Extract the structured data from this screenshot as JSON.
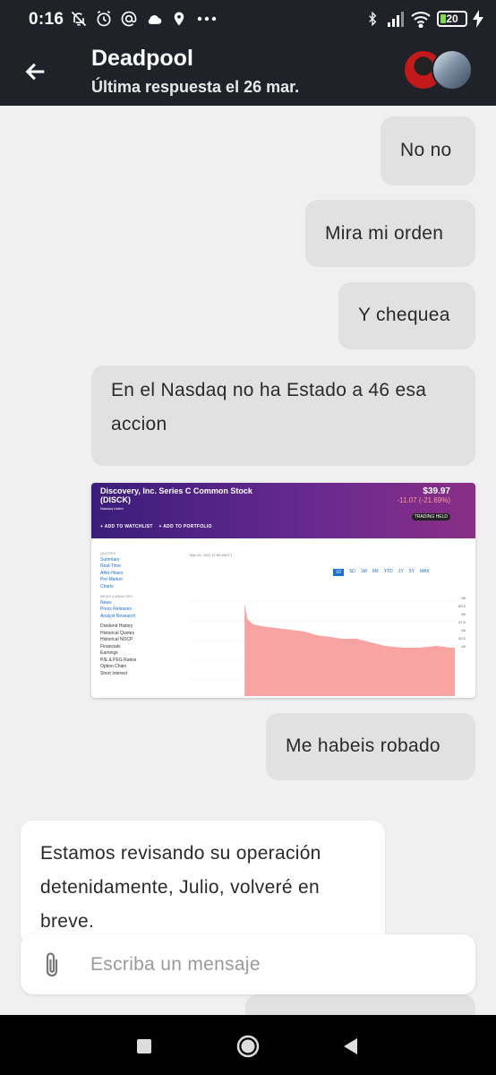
{
  "status_bar": {
    "time": "0:16",
    "battery_level": "20",
    "icons_left": [
      "notifications-off-icon",
      "alarm-icon",
      "at-icon",
      "cloud-icon",
      "location-icon",
      "more-dots-icon"
    ],
    "icons_right": [
      "bluetooth-icon",
      "signal-icon",
      "wifi-icon",
      "battery-icon",
      "charging-icon"
    ]
  },
  "header": {
    "title": "Deadpool",
    "subtitle": "Última respuesta el 26 mar."
  },
  "messages": [
    {
      "side": "user",
      "text": "No no"
    },
    {
      "side": "user",
      "text": "Mira mi orden"
    },
    {
      "side": "user",
      "text": "Y chequea"
    },
    {
      "side": "user",
      "text": "En el Nasdaq no ha Estado a 46 esa accion"
    },
    {
      "side": "user",
      "type": "image"
    },
    {
      "side": "user",
      "text": "Me habeis robado"
    },
    {
      "side": "agent",
      "text": "Estamos revisando su operación detenidamente, Julio, volveré en breve."
    }
  ],
  "screenshot": {
    "company": "Discovery, Inc. Series C Common Stock",
    "ticker": "(DISCK)",
    "exchange": "Nasdaq Listed",
    "price": "$39.97",
    "change": "-11.07 (-21.69%)",
    "add_watchlist": "+ ADD TO WATCHLIST",
    "add_portfolio": "+ ADD TO PORTFOLIO",
    "trading_halted": "TRADING HELD",
    "date_line": "Mar 26, 2021 11:59 AM ET",
    "sidebar_quotes_head": "QUOTES",
    "sidebar_quotes": [
      "Summary",
      "Real-Time",
      "After-Hours",
      "Pre-Market",
      "Charts"
    ],
    "sidebar_news_head": "NEWS & ANALYSIS",
    "sidebar_news": [
      "News",
      "Press Releases",
      "Analyst Research"
    ],
    "sidebar_other": [
      "Dividend History",
      "Historical Quotes",
      "Historical NOCP",
      "Financials",
      "Earnings",
      "P/E & PEG Ratios",
      "Option Chain",
      "Short Interest"
    ],
    "ranges": [
      "1D",
      "5D",
      "1M",
      "6M",
      "YTD",
      "1Y",
      "5Y",
      "MAX"
    ],
    "y_ticks": [
      "55",
      "52.5",
      "50",
      "47.5",
      "45",
      "42.5",
      "40"
    ]
  },
  "input": {
    "placeholder": "Escriba un mensaje"
  }
}
